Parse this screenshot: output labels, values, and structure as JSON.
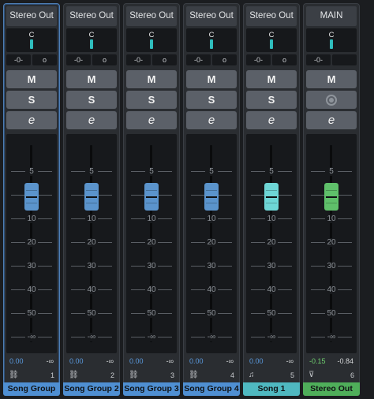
{
  "strips": [
    {
      "id": "s1",
      "output": "Stereo Out",
      "pan": "C",
      "io_left": "-0-",
      "io_right": "o",
      "mute": "M",
      "solo": "S",
      "edit": "e",
      "scale": [
        "5",
        "10",
        "20",
        "30",
        "40",
        "50",
        "-∞"
      ],
      "val_left": "0.00",
      "val_right": "-∞",
      "number": "1",
      "name": "Song Group",
      "name_color": "#4f8fd2",
      "cap_color": "#5b94cc",
      "val_color": "#5a9be0",
      "icon": "group-icon",
      "selected": true,
      "level": 0.0
    },
    {
      "id": "s2",
      "output": "Stereo Out",
      "pan": "C",
      "io_left": "-0-",
      "io_right": "o",
      "mute": "M",
      "solo": "S",
      "edit": "e",
      "scale": [
        "5",
        "10",
        "20",
        "30",
        "40",
        "50",
        "-∞"
      ],
      "val_left": "0.00",
      "val_right": "-∞",
      "number": "2",
      "name": "Song Group 2",
      "name_color": "#4f8fd2",
      "cap_color": "#5b94cc",
      "val_color": "#5a9be0",
      "icon": "group-icon",
      "selected": false,
      "level": 0.0
    },
    {
      "id": "s3",
      "output": "Stereo Out",
      "pan": "C",
      "io_left": "-0-",
      "io_right": "o",
      "mute": "M",
      "solo": "S",
      "edit": "e",
      "scale": [
        "5",
        "10",
        "20",
        "30",
        "40",
        "50",
        "-∞"
      ],
      "val_left": "0.00",
      "val_right": "-∞",
      "number": "3",
      "name": "Song Group 3",
      "name_color": "#4f8fd2",
      "cap_color": "#5b94cc",
      "val_color": "#5a9be0",
      "icon": "group-icon",
      "selected": false,
      "level": 0.0
    },
    {
      "id": "s4",
      "output": "Stereo Out",
      "pan": "C",
      "io_left": "-0-",
      "io_right": "o",
      "mute": "M",
      "solo": "S",
      "edit": "e",
      "scale": [
        "5",
        "10",
        "20",
        "30",
        "40",
        "50",
        "-∞"
      ],
      "val_left": "0.00",
      "val_right": "-∞",
      "number": "4",
      "name": "Song Group 4",
      "name_color": "#4f8fd2",
      "cap_color": "#5b94cc",
      "val_color": "#5a9be0",
      "icon": "group-icon",
      "selected": false,
      "level": 0.0
    },
    {
      "id": "s5",
      "output": "Stereo Out",
      "pan": "C",
      "io_left": "-0-",
      "io_right": "o",
      "mute": "M",
      "solo": "S",
      "edit": "e",
      "scale": [
        "5",
        "10",
        "20",
        "30",
        "40",
        "50",
        "-∞"
      ],
      "val_left": "0.00",
      "val_right": "-∞",
      "number": "5",
      "name": "Song 1",
      "name_color": "#4fb8c0",
      "cap_color": "#6ed6d6",
      "val_color": "#5a9be0",
      "icon": "note-icon",
      "selected": false,
      "level": 0.0
    },
    {
      "id": "s6",
      "output": "MAIN",
      "pan": "C",
      "io_left": "-0-",
      "io_right": "",
      "mute": "M",
      "solo": "monitor",
      "edit": "e",
      "scale": [
        "5",
        "10",
        "20",
        "30",
        "40",
        "50",
        "-∞"
      ],
      "val_left": "-0.15",
      "val_right": "-0.84",
      "number": "6",
      "name": "Stereo Out",
      "name_color": "#4fae5a",
      "cap_color": "#5fc06a",
      "val_color": "#6fcf6f",
      "icon": "output-icon",
      "selected": false,
      "level": -0.15
    }
  ],
  "icons": {
    "group-icon": "⛓",
    "note-icon": "♫",
    "output-icon": "⊽"
  }
}
